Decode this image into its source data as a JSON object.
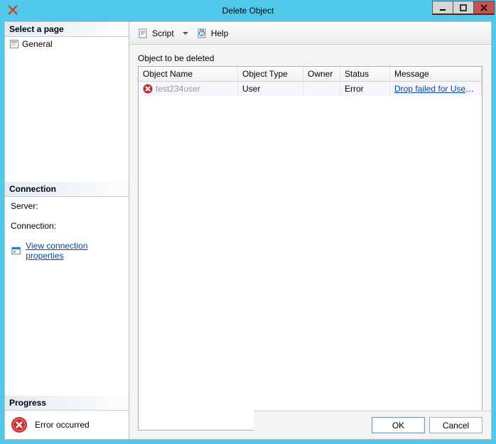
{
  "window": {
    "title": "Delete Object"
  },
  "sidebar": {
    "select_page_label": "Select a page",
    "pages": [
      {
        "label": "General"
      }
    ],
    "connection_label": "Connection",
    "server_label": "Server:",
    "connection_row_label": "Connection:",
    "view_conn_link": "View connection properties",
    "progress_label": "Progress",
    "progress_status": "Error occurred"
  },
  "toolbar": {
    "script_label": "Script",
    "help_label": "Help"
  },
  "content": {
    "section_label": "Object to be deleted",
    "columns": {
      "name": "Object Name",
      "type": "Object Type",
      "owner": "Owner",
      "status": "Status",
      "message": "Message"
    },
    "row": {
      "name": "test234user",
      "type": "User",
      "owner": "",
      "status": "Error",
      "message": "Drop failed for User 'te..."
    }
  },
  "footer": {
    "ok": "OK",
    "cancel": "Cancel"
  }
}
